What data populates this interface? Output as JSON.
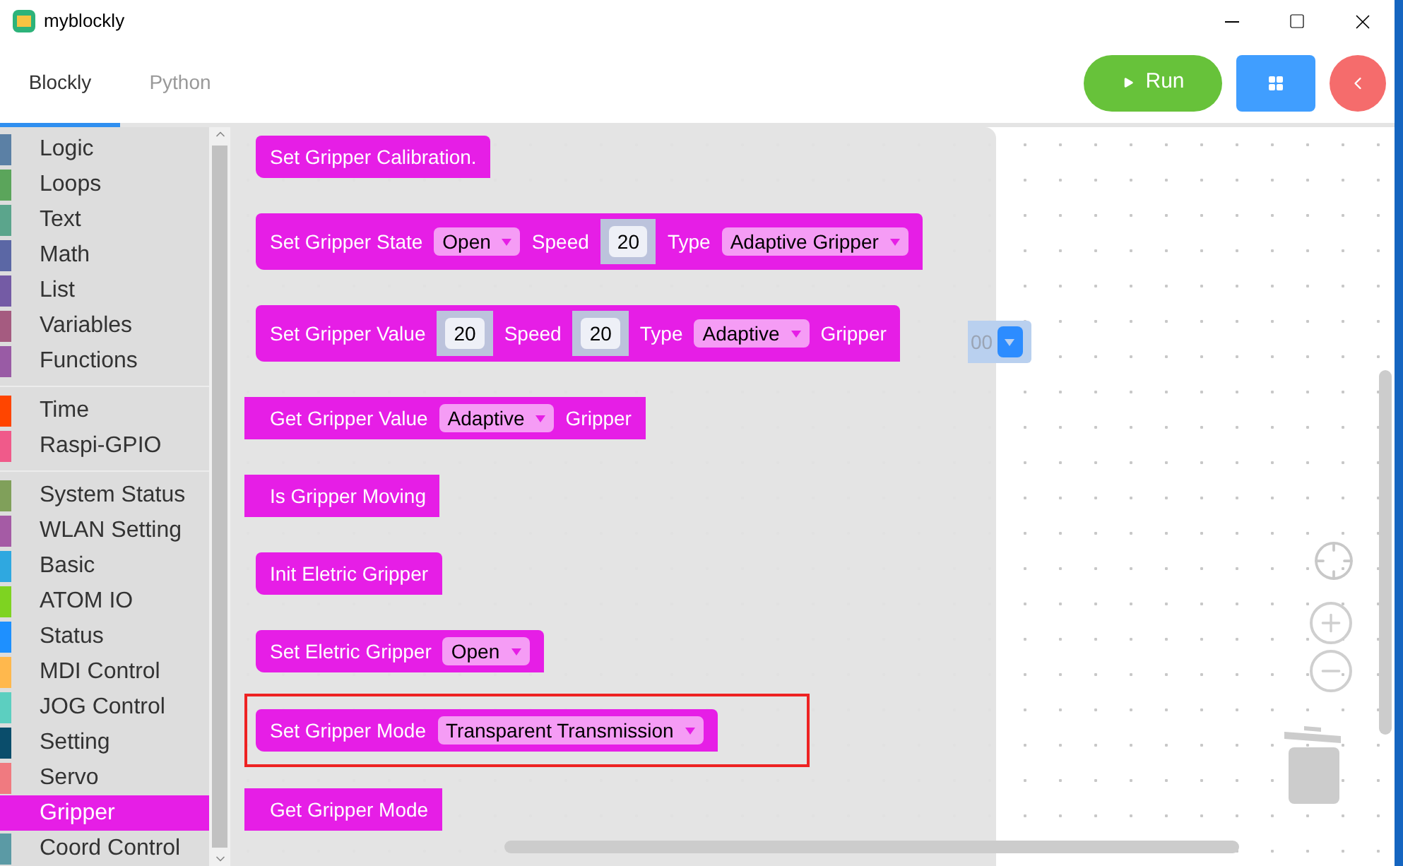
{
  "window": {
    "title": "myblockly"
  },
  "tabs": [
    {
      "label": "Blockly",
      "selected": true
    },
    {
      "label": "Python",
      "selected": false
    }
  ],
  "toolbar": {
    "run_label": "Run"
  },
  "sidebar": {
    "groups": [
      [
        {
          "label": "Logic",
          "color": "#5b80a5",
          "selected": false
        },
        {
          "label": "Loops",
          "color": "#5ba55b",
          "selected": false
        },
        {
          "label": "Text",
          "color": "#5ba58c",
          "selected": false
        },
        {
          "label": "Math",
          "color": "#5b67a5",
          "selected": false
        },
        {
          "label": "List",
          "color": "#745ba5",
          "selected": false
        },
        {
          "label": "Variables",
          "color": "#a55b80",
          "selected": false
        },
        {
          "label": "Functions",
          "color": "#995ba5",
          "selected": false
        }
      ],
      [
        {
          "label": "Time",
          "color": "#ff4500",
          "selected": false
        },
        {
          "label": "Raspi-GPIO",
          "color": "#f05a8a",
          "selected": false
        }
      ],
      [
        {
          "label": "System Status",
          "color": "#80a05a",
          "selected": false
        },
        {
          "label": "WLAN Setting",
          "color": "#a55ba5",
          "selected": false
        },
        {
          "label": "Basic",
          "color": "#2fa8e0",
          "selected": false
        },
        {
          "label": "ATOM IO",
          "color": "#7ed321",
          "selected": false
        },
        {
          "label": "Status",
          "color": "#1e90ff",
          "selected": false
        },
        {
          "label": "MDI Control",
          "color": "#ffb84d",
          "selected": false
        },
        {
          "label": "JOG Control",
          "color": "#5ccfc0",
          "selected": false
        },
        {
          "label": "Setting",
          "color": "#0a4d6b",
          "selected": false
        },
        {
          "label": "Servo",
          "color": "#f07a80",
          "selected": false
        },
        {
          "label": "Gripper",
          "color": "#e61ee6",
          "selected": true
        },
        {
          "label": "Coord Control",
          "color": "#5b9aa5",
          "selected": false
        }
      ]
    ]
  },
  "flyout": {
    "blocks": [
      {
        "kind": "statement",
        "highlighted": false,
        "parts": [
          {
            "kind": "label",
            "text": "Set Gripper Calibration."
          }
        ]
      },
      {
        "kind": "statement",
        "highlighted": false,
        "parts": [
          {
            "kind": "label",
            "text": "Set Gripper State"
          },
          {
            "kind": "dropdown",
            "text": "Open"
          },
          {
            "kind": "label",
            "text": "Speed"
          },
          {
            "kind": "number",
            "text": "20"
          },
          {
            "kind": "label",
            "text": "Type"
          },
          {
            "kind": "dropdown",
            "text": "Adaptive Gripper"
          }
        ]
      },
      {
        "kind": "statement",
        "highlighted": false,
        "parts": [
          {
            "kind": "label",
            "text": "Set Gripper Value"
          },
          {
            "kind": "number",
            "text": "20"
          },
          {
            "kind": "label",
            "text": "Speed"
          },
          {
            "kind": "number",
            "text": "20"
          },
          {
            "kind": "label",
            "text": "Type"
          },
          {
            "kind": "dropdown",
            "text": "Adaptive"
          },
          {
            "kind": "label",
            "text": "Gripper"
          }
        ]
      },
      {
        "kind": "value",
        "highlighted": false,
        "parts": [
          {
            "kind": "label",
            "text": "Get Gripper Value"
          },
          {
            "kind": "dropdown",
            "text": "Adaptive"
          },
          {
            "kind": "label",
            "text": "Gripper"
          }
        ]
      },
      {
        "kind": "value",
        "highlighted": false,
        "parts": [
          {
            "kind": "label",
            "text": "Is Gripper Moving"
          }
        ]
      },
      {
        "kind": "statement",
        "highlighted": false,
        "parts": [
          {
            "kind": "label",
            "text": "Init Eletric Gripper"
          }
        ]
      },
      {
        "kind": "statement",
        "highlighted": false,
        "parts": [
          {
            "kind": "label",
            "text": "Set Eletric Gripper"
          },
          {
            "kind": "dropdown",
            "text": "Open"
          }
        ]
      },
      {
        "kind": "statement",
        "highlighted": true,
        "parts": [
          {
            "kind": "label",
            "text": "Set Gripper Mode"
          },
          {
            "kind": "dropdown",
            "text": "Transparent Transmission"
          }
        ]
      },
      {
        "kind": "value",
        "highlighted": false,
        "parts": [
          {
            "kind": "label",
            "text": "Get Gripper Mode"
          }
        ]
      }
    ]
  },
  "workspace": {
    "hidden_block_value": "00"
  }
}
